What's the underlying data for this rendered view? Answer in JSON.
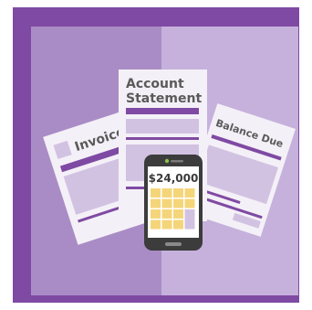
{
  "illustration": {
    "colors": {
      "frame": "#7f4aa3",
      "panel_left": "#a98cc5",
      "panel_right": "#c6b1dc",
      "doc_paper": "#f4f0f7",
      "doc_accent": "#7f4aa3",
      "doc_light": "#d2c2e2",
      "phone_body": "#3c3c3c",
      "phone_screen": "#ffffff",
      "keypad_key": "#f5d57a",
      "keypad_wide": "#d2c2e2",
      "status_light": "#8bc34a"
    },
    "documents": {
      "invoice": {
        "title": "Invoice"
      },
      "statement": {
        "title_line1": "Account",
        "title_line2": "Statement"
      },
      "balance": {
        "title": "Balance Due"
      }
    },
    "phone": {
      "amount": "$24,000",
      "keypad_rows": 4,
      "keypad_cols": 4
    }
  }
}
